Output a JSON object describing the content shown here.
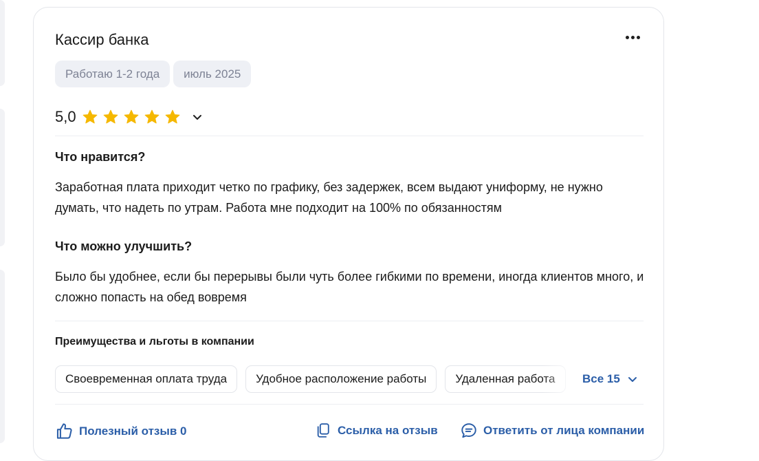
{
  "review": {
    "title": "Кассир банка",
    "tags": [
      "Работаю 1-2 года",
      "июль 2025"
    ],
    "rating": {
      "value_text": "5,0",
      "stars": 5,
      "star_color": "#f5b800"
    },
    "likes": {
      "heading": "Что нравится?",
      "text": "Заработная плата приходит четко по графику, без задержек, всем выдают униформу, не нужно думать, что надеть по утрам. Работа мне подходит на 100% по обязанностям"
    },
    "improve": {
      "heading": "Что можно улучшить?",
      "text": "Было бы удобнее, если бы перерывы были чуть более гибкими по времени, иногда клиентов много, и сложно попасть на обед вовремя"
    },
    "benefits": {
      "heading": "Преимущества и льготы в компании",
      "chips": [
        "Своевременная оплата труда",
        "Удобное расположение работы",
        "Удаленная работа"
      ],
      "all_label": "Все 15"
    },
    "actions": {
      "useful": "Полезный отзыв 0",
      "link": "Ссылка на отзыв",
      "reply": "Ответить от лица компании"
    },
    "icons": {
      "menu": "more-horizontal-icon",
      "expand": "chevron-down-icon",
      "useful": "thumbs-up-icon",
      "link": "copy-link-icon",
      "reply": "chat-bubble-icon"
    },
    "colors": {
      "accent": "#2b5ea8",
      "tag_bg": "#eef0f5",
      "tag_text": "#7d8294"
    }
  }
}
